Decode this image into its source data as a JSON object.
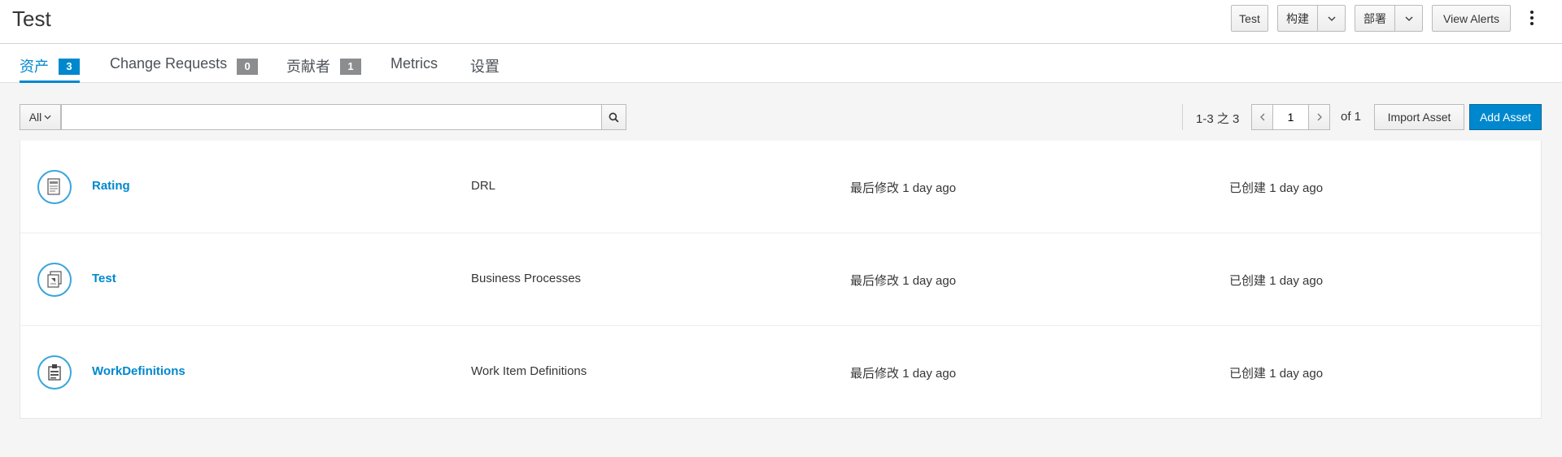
{
  "header": {
    "title": "Test",
    "buttons": {
      "test": "Test",
      "build": "构建",
      "deploy": "部署",
      "view_alerts": "View Alerts"
    }
  },
  "tabs": [
    {
      "label": "资产",
      "badge": "3",
      "active": true
    },
    {
      "label": "Change Requests",
      "badge": "0"
    },
    {
      "label": "贡献者",
      "badge": "1"
    },
    {
      "label": "Metrics"
    },
    {
      "label": "设置"
    }
  ],
  "toolbar": {
    "filter": "All",
    "search_value": "",
    "range": "1-3 之 3",
    "page": "1",
    "of_pages": "of 1",
    "import_label": "Import Asset",
    "add_label": "Add Asset"
  },
  "assets": [
    {
      "name": "Rating",
      "type": "DRL",
      "modified_label": "最后修改",
      "modified": "1 day ago",
      "created_label": "已创建",
      "created": "1 day ago",
      "icon": "drl-file-icon"
    },
    {
      "name": "Test",
      "type": "Business Processes",
      "modified_label": "最后修改",
      "modified": "1 day ago",
      "created_label": "已创建",
      "created": "1 day ago",
      "icon": "process-icon"
    },
    {
      "name": "WorkDefinitions",
      "type": "Work Item Definitions",
      "modified_label": "最后修改",
      "modified": "1 day ago",
      "created_label": "已创建",
      "created": "1 day ago",
      "icon": "work-item-icon"
    }
  ],
  "colors": {
    "accent": "#0088ce",
    "icon_ring": "#39a5dc"
  }
}
